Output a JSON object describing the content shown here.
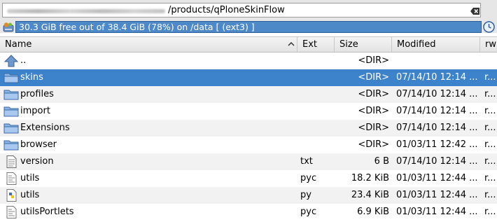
{
  "location": {
    "path_text": "/products/qPloneSkinFlow"
  },
  "disk_status": {
    "text": "30.3 GiB free out of 38.4 GiB (78%) on /data [ (ext3) ]",
    "icon": "drive-icon"
  },
  "columns": {
    "name": "Name",
    "ext": "Ext",
    "size": "Size",
    "modified": "Modified",
    "rw": "rw"
  },
  "rows": [
    {
      "name": "..",
      "ext": "",
      "size": "<DIR>",
      "modified": "",
      "rw": "",
      "icon": "up-arrow-icon"
    },
    {
      "name": "skins",
      "ext": "",
      "size": "<DIR>",
      "modified": "07/14/10 12:14 ...",
      "rw": "r...",
      "icon": "folder-icon"
    },
    {
      "name": "profiles",
      "ext": "",
      "size": "<DIR>",
      "modified": "07/14/10 12:14 ...",
      "rw": "r...",
      "icon": "folder-icon"
    },
    {
      "name": "import",
      "ext": "",
      "size": "<DIR>",
      "modified": "07/14/10 12:14 ...",
      "rw": "r...",
      "icon": "folder-icon"
    },
    {
      "name": "Extensions",
      "ext": "",
      "size": "<DIR>",
      "modified": "07/14/10 12:14 ...",
      "rw": "r...",
      "icon": "folder-icon"
    },
    {
      "name": "browser",
      "ext": "",
      "size": "<DIR>",
      "modified": "01/03/11 12:42 ...",
      "rw": "r...",
      "icon": "folder-icon"
    },
    {
      "name": "version",
      "ext": "txt",
      "size": "6 B",
      "modified": "07/14/10 12:14 ...",
      "rw": "r...",
      "icon": "text-file-icon"
    },
    {
      "name": "utils",
      "ext": "pyc",
      "size": "18.2 KiB",
      "modified": "01/03/11 12:44 ...",
      "rw": "r...",
      "icon": "binary-file-icon"
    },
    {
      "name": "utils",
      "ext": "py",
      "size": "23.4 KiB",
      "modified": "01/03/11 12:44 ...",
      "rw": "r...",
      "icon": "python-file-icon"
    },
    {
      "name": "utilsPortlets",
      "ext": "pyc",
      "size": "6.9 KiB",
      "modified": "01/03/11 12:44 ...",
      "rw": "r...",
      "icon": "binary-file-icon"
    }
  ],
  "selected_row": 1,
  "colors": {
    "selection": "#3d83cc",
    "status_bar": "#4d89c9"
  }
}
